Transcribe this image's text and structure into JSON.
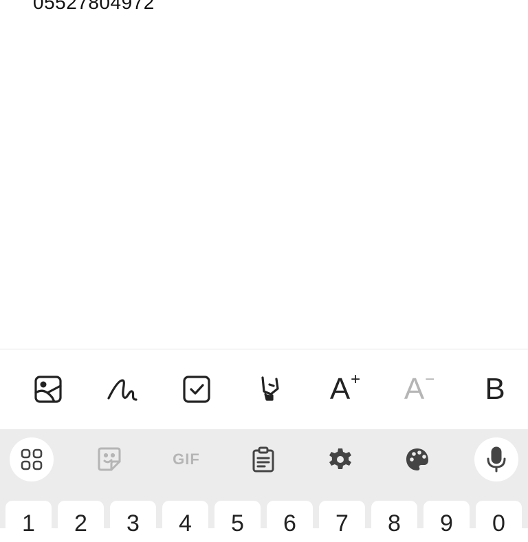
{
  "note": {
    "text": "05527804972"
  },
  "toolbar": {
    "items": [
      {
        "name": "insert-image",
        "icon": "image-icon"
      },
      {
        "name": "handwriting",
        "icon": "scribble-icon"
      },
      {
        "name": "checkbox",
        "icon": "checkbox-icon"
      },
      {
        "name": "highlighter",
        "icon": "highlighter-icon"
      },
      {
        "name": "increase-font",
        "label": "A",
        "sup": "+"
      },
      {
        "name": "decrease-font",
        "label": "A",
        "sup": "−"
      },
      {
        "name": "bold",
        "label": "B"
      }
    ]
  },
  "keyboard_bar": {
    "gif_label": "GIF",
    "items": [
      "apps-grid-icon",
      "sticker-icon",
      "gif-icon",
      "clipboard-icon",
      "settings-gear-icon",
      "palette-icon",
      "microphone-icon"
    ]
  },
  "keyboard": {
    "number_row": [
      "1",
      "2",
      "3",
      "4",
      "5",
      "6",
      "7",
      "8",
      "9",
      "0"
    ]
  },
  "colors": {
    "keyboard_bg": "#ececec",
    "key_bg": "#ffffff",
    "icon": "#222222",
    "disabled": "#b5b5b5"
  }
}
